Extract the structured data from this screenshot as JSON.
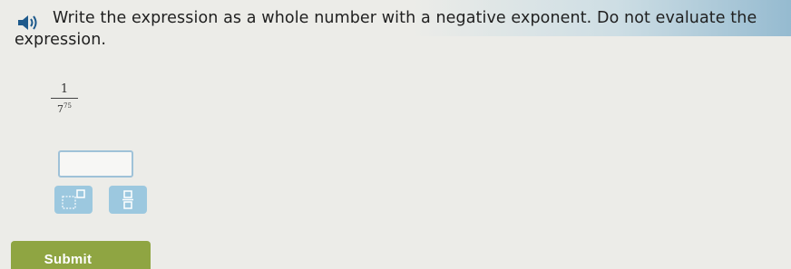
{
  "question": {
    "text": "Write the expression as a whole number with a negative exponent. Do not evaluate the expression."
  },
  "expression": {
    "numerator": "1",
    "base": "7",
    "exponent": "75"
  },
  "answer": {
    "value": ""
  },
  "toolbar": {
    "exponent_icon": "exponent-template-icon",
    "fraction_icon": "fraction-template-icon"
  },
  "submit": {
    "label": "Submit"
  },
  "colors": {
    "tool_button": "#9cc8df",
    "submit_button": "#8fa542",
    "input_border": "#9fc2d8"
  }
}
